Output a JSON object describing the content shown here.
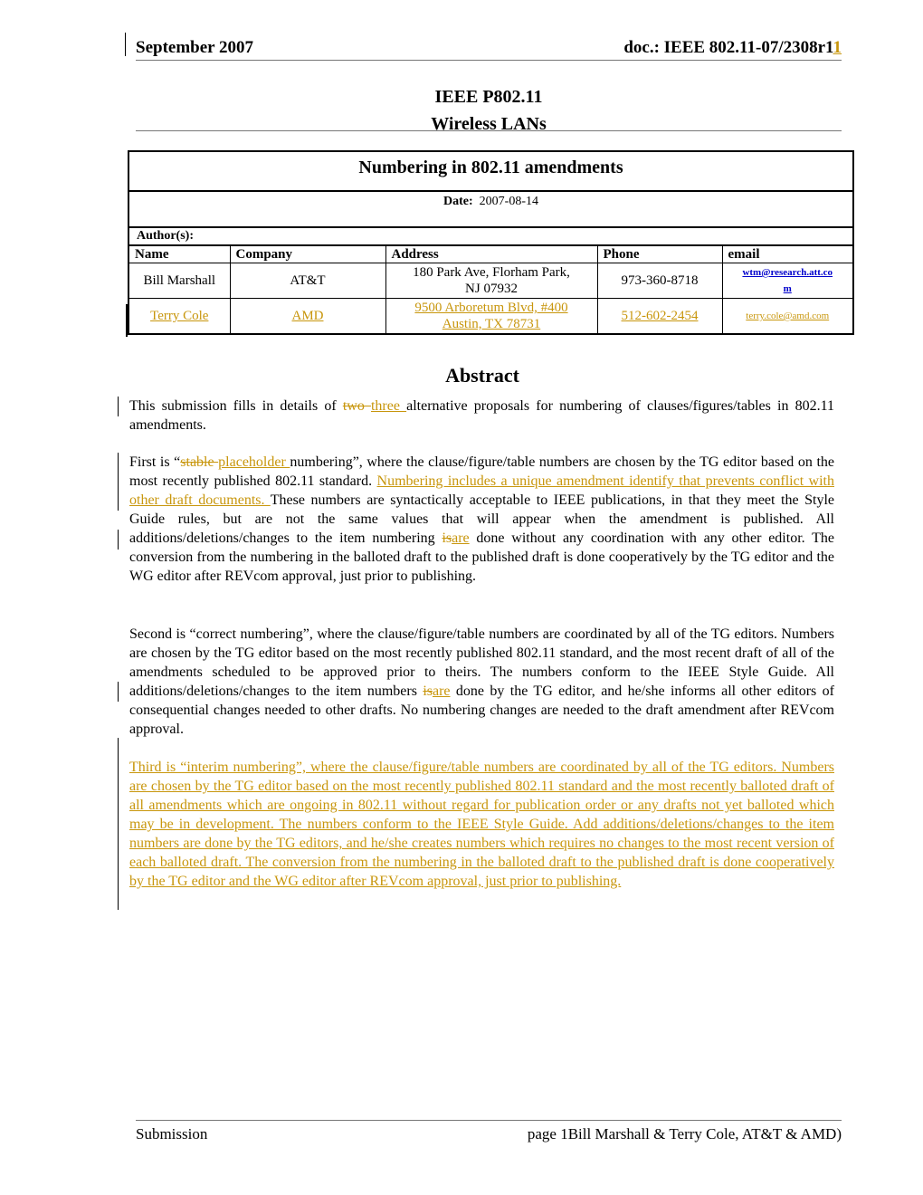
{
  "header": {
    "date": "September 2007",
    "doc_prefix": "doc.: IEEE 802.11-07/2308r1",
    "doc_revision_inserted": "1"
  },
  "title_block": {
    "line1": "IEEE P802.11",
    "line2": "Wireless LANs"
  },
  "cover": {
    "title": "Numbering in 802.11 amendments",
    "date_label": "Date:",
    "date_value": "2007-08-14",
    "authors_label": "Author(s):",
    "columns": [
      "Name",
      "Company",
      "Address",
      "Phone",
      "email"
    ],
    "authors": [
      {
        "name": "Bill Marshall",
        "company": "AT&T",
        "address_line1": "180 Park Ave, Florham Park,",
        "address_line2": "NJ 07932",
        "phone": "973-360-8718",
        "email_line1": "wtm@research.att.co",
        "email_line2": "m",
        "inserted": false
      },
      {
        "name": "Terry Cole",
        "company": "AMD",
        "address_line1": "9500 Arboretum Blvd, #400",
        "address_line2": "Austin, TX 78731",
        "phone": "512-602-2454",
        "email_line1": "terry.cole@amd.com",
        "email_line2": "",
        "inserted": true
      }
    ]
  },
  "abstract": {
    "heading": "Abstract",
    "p1": {
      "a": "This submission fills in details of ",
      "del": "two ",
      "ins": "three ",
      "b": "alternative proposals for numbering of clauses/figures/tables in 802.11 amendments."
    },
    "p2": {
      "a": "First is “",
      "del1": "stable ",
      "ins1": "placeholder ",
      "b": "numbering”, where the clause/figure/table numbers are chosen by the TG editor based on the most recently published 802.11 standard.  ",
      "ins2": "Numbering includes a unique amendment identify that prevents conflict with other draft documents. ",
      "c": "These numbers are syntactically acceptable to IEEE publications, in that they meet the Style Guide rules, but are not the same values that will appear when the amendment is published.  All additions/deletions/changes to the item numbering ",
      "del3": "is",
      "ins3": "are",
      "d": " done without any coordination with any other editor. The conversion from the numbering in the balloted draft to the published draft is done cooperatively by the TG editor and the WG editor after REVcom approval, just prior to publishing."
    },
    "p3": {
      "a": "Second is “correct numbering”, where the clause/figure/table numbers are coordinated by all of the TG editors.  Numbers are chosen by the TG editor based on the most recently published 802.11 standard, and the most recent draft of all of the amendments scheduled to be approved prior to theirs.  The numbers conform to the IEEE Style Guide.  All additions/deletions/changes to the item numbers ",
      "del": "is",
      "ins": "are",
      "b": " done by the TG editor, and he/she informs all other editors of consequential changes needed to other drafts.  No numbering changes are needed to the draft amendment after REVcom approval."
    },
    "p4": {
      "ins": "Third is “interim numbering”, where the clause/figure/table numbers are coordinated by all of the TG editors. Numbers are chosen by the TG editor based on the most recently published 802.11 standard and the most recently balloted draft of all amendments which are ongoing in 802.11 without regard for publication order or any drafts not yet balloted which may be in development. The numbers conform to the IEEE Style Guide. Add additions/deletions/changes to the item numbers are done by the TG editors, and he/she creates numbers which requires no changes to the most recent version of each balloted draft. The conversion from the numbering in the balloted draft to the published draft is done cooperatively by the TG editor and the WG editor after REVcom approval, just prior to publishing."
    }
  },
  "footer": {
    "left": "Submission",
    "right": "page 1Bill Marshall & Terry Cole, AT&T & AMD)"
  },
  "colors": {
    "revision_mark": "#c8960c",
    "email_link": "#0000cc"
  }
}
